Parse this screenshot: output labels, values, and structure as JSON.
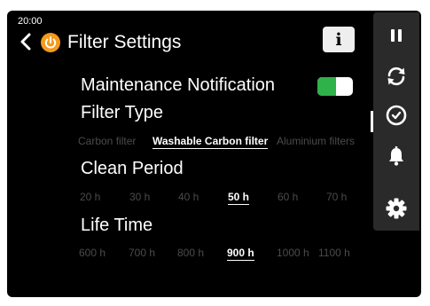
{
  "status": {
    "time": "20:00"
  },
  "header": {
    "title": "Filter Settings",
    "info_label": "i"
  },
  "maintenance": {
    "label": "Maintenance Notification",
    "enabled": true
  },
  "filter_type": {
    "label": "Filter Type",
    "options": [
      "Carbon filter",
      "Washable Carbon filter",
      "Aluminium filters"
    ],
    "selected": "Washable Carbon filter"
  },
  "clean_period": {
    "label": "Clean Period",
    "options": [
      "20 h",
      "30 h",
      "40 h",
      "50 h",
      "60 h",
      "70 h"
    ],
    "selected": "50 h"
  },
  "life_time": {
    "label": "Life Time",
    "options": [
      "600 h",
      "700 h",
      "800 h",
      "900 h",
      "1000 h",
      "1100 h"
    ],
    "selected": "900 h"
  },
  "side_panel": {
    "icons": [
      "pause-icon",
      "refresh-icon",
      "timer-icon",
      "bell-icon",
      "gear-icon"
    ]
  },
  "colors": {
    "background": "#000000",
    "toggle_on": "#2fb24a",
    "brand": "#f59a1c",
    "inactive_option": "#4b4b4b",
    "panel": "#2a2a2a"
  }
}
